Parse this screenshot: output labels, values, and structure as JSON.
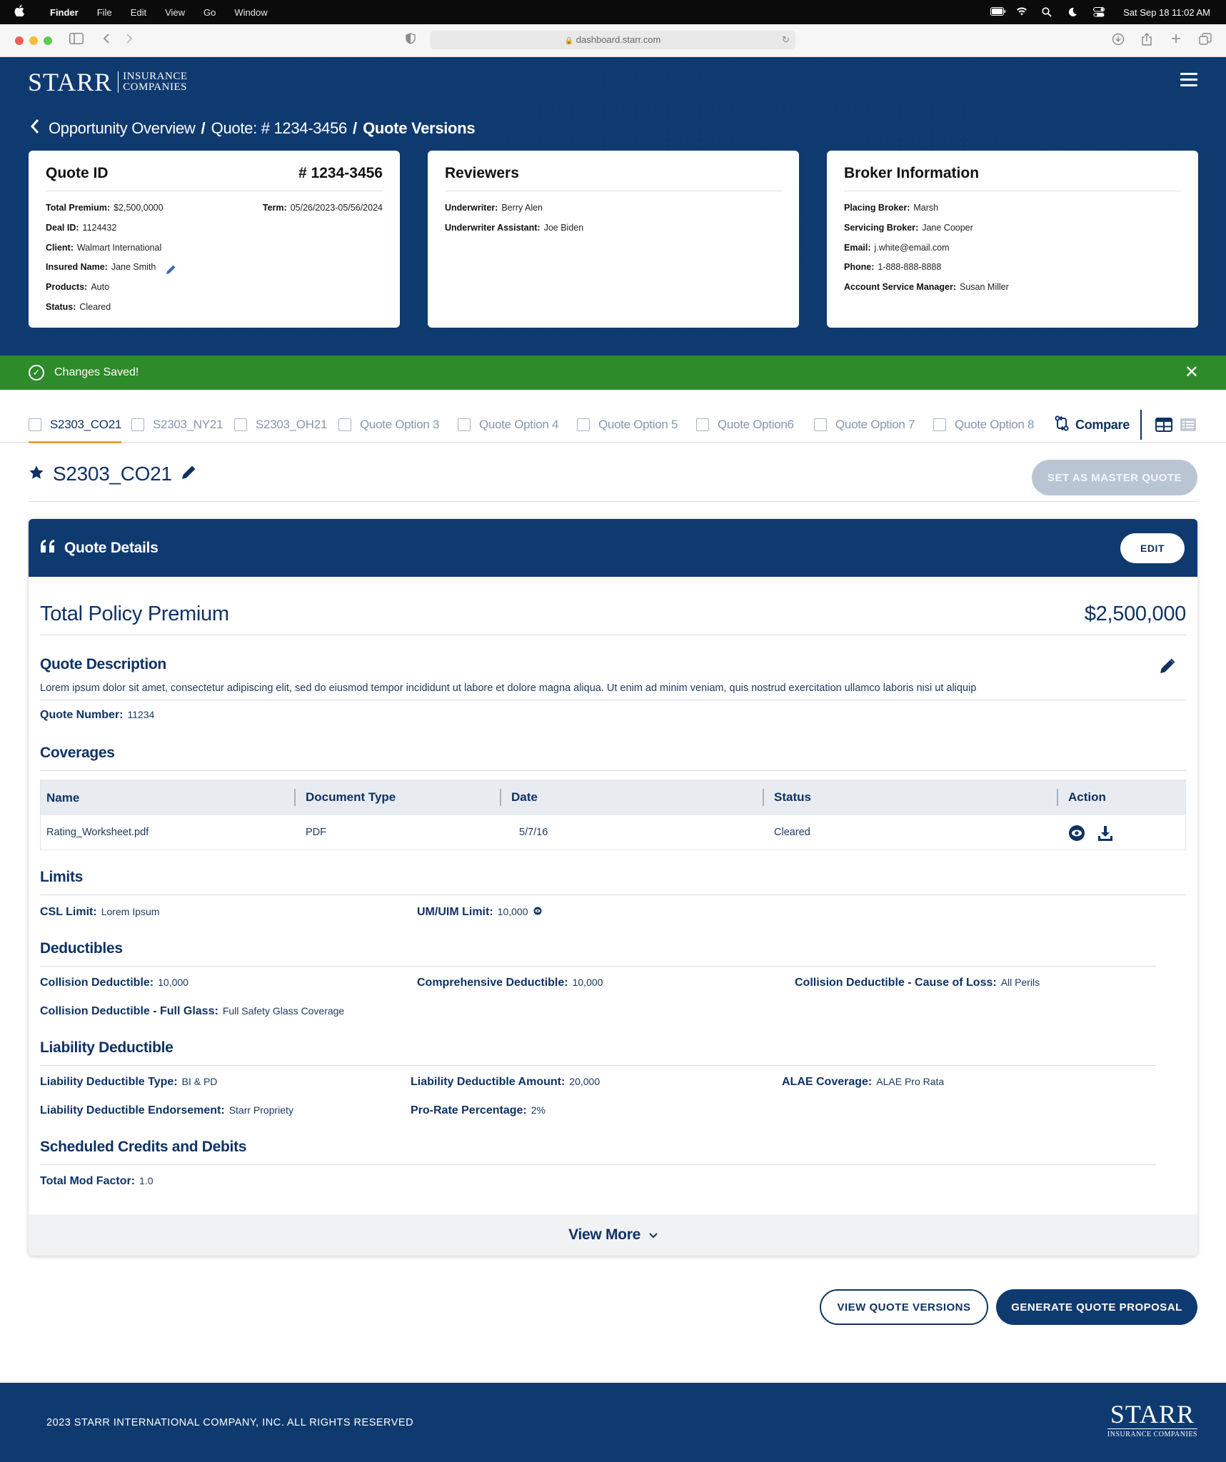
{
  "menubar": {
    "app": "Finder",
    "items": [
      "File",
      "Edit",
      "View",
      "Go",
      "Window"
    ],
    "datetime": "Sat Sep 18  11:02 AM"
  },
  "browser": {
    "url": "dashboard.starr.com"
  },
  "logo": {
    "main": "STARR",
    "line1": "INSURANCE",
    "line2": "COMPANIES"
  },
  "breadcrumb": {
    "items": [
      "Opportunity Overview",
      "Quote: # 1234-3456",
      "Quote Versions"
    ],
    "separator": "/"
  },
  "quote_card": {
    "title": "Quote ID",
    "id": "# 1234-3456",
    "fields": [
      {
        "label": "Total Premium:",
        "value": "$2,500,0000"
      },
      {
        "label": "Deal ID:",
        "value": "1124432"
      },
      {
        "label": "Client:",
        "value": "Walmart International"
      },
      {
        "label": "Insured Name:",
        "value": "Jane Smith"
      },
      {
        "label": "Products:",
        "value": "Auto"
      },
      {
        "label": "Status:",
        "value": "Cleared"
      }
    ],
    "term_label": "Term:",
    "term_value": "05/26/2023-05/56/2024"
  },
  "reviewers_card": {
    "title": "Reviewers",
    "fields": [
      {
        "label": "Underwriter:",
        "value": "Berry Alen"
      },
      {
        "label": "Underwriter Assistant:",
        "value": "Joe Biden"
      }
    ]
  },
  "broker_card": {
    "title": "Broker Information",
    "fields": [
      {
        "label": "Placing Broker:",
        "value": "Marsh"
      },
      {
        "label": "Servicing Broker:",
        "value": "Jane Cooper"
      },
      {
        "label": "Email:",
        "value": "j.white@email.com"
      },
      {
        "label": "Phone:",
        "value": "1-888-888-8888"
      },
      {
        "label": "Account Service Manager:",
        "value": "Susan Miller"
      }
    ]
  },
  "alert": {
    "message": "Changes Saved!",
    "color": "#2e8b2a"
  },
  "tabs": [
    "S2303_CO21",
    "S2303_NY21",
    "S2303_OH21",
    "Quote Option 3",
    "Quote Option 4",
    "Quote Option 5",
    "Quote Option6",
    "Quote Option 7",
    "Quote Option 8"
  ],
  "compare_label": "Compare",
  "quote": {
    "name": "S2303_CO21",
    "master_button": "SET AS MASTER QUOTE"
  },
  "details": {
    "title": "Quote Details",
    "edit_label": "EDIT",
    "total_label": "Total Policy Premium",
    "total_value": "$2,500,000",
    "description_heading": "Quote Description",
    "description_text": "Lorem ipsum dolor sit amet, consectetur adipiscing elit, sed do eiusmod tempor incididunt ut labore et dolore magna aliqua. Ut enim ad minim veniam, quis nostrud exercitation ullamco laboris nisi ut aliquip",
    "quote_number_label": "Quote Number:",
    "quote_number_value": "11234",
    "coverages_heading": "Coverages",
    "coverages_table": {
      "headers": [
        "Name",
        "Document Type",
        "Date",
        "Status",
        "Action"
      ],
      "rows": [
        [
          "Rating_Worksheet.pdf",
          "PDF",
          "5/7/16",
          "Cleared"
        ]
      ]
    },
    "limits_heading": "Limits",
    "limits": [
      {
        "label": "CSL Limit:",
        "value": "Lorem Ipsum"
      },
      {
        "label": "UM/UIM Limit:",
        "value": "10,000"
      }
    ],
    "deductibles_heading": "Deductibles",
    "deductibles": [
      {
        "label": "Collision Deductible:",
        "value": "10,000"
      },
      {
        "label": "Comprehensive Deductible:",
        "value": "10,000"
      },
      {
        "label": "Collision Deductible - Cause of Loss:",
        "value": "All Perils"
      },
      {
        "label": "Collision Deductible - Full Glass:",
        "value": "Full Safety Glass Coverage"
      }
    ],
    "liability_heading": "Liability Deductible",
    "liability": [
      {
        "label": "Liability Deductible Type:",
        "value": "BI & PD"
      },
      {
        "label": "Liability Deductible Amount:",
        "value": "20,000"
      },
      {
        "label": "ALAE Coverage:",
        "value": "ALAE Pro Rata"
      },
      {
        "label": "Liability Deductible Endorsement:",
        "value": "Starr Propriety"
      },
      {
        "label": "Pro-Rate Percentage:",
        "value": "2%"
      }
    ],
    "credits_heading": "Scheduled Credits and Debits",
    "credits": [
      {
        "label": "Total Mod Factor:",
        "value": "1.0"
      }
    ],
    "view_more": "View More"
  },
  "actions": {
    "view_versions": "VIEW QUOTE VERSIONS",
    "generate_proposal": "GENERATE QUOTE PROPOSAL"
  },
  "footer": {
    "copyright": "2023 STARR INTERNATIONAL COMPANY, INC. ALL RIGHTS RESERVED",
    "logo_main": "STARR",
    "logo_sub": "INSURANCE COMPANIES"
  },
  "colors": {
    "brand_navy": "#0f3a70",
    "accent_gold": "#e6a42b",
    "success_green": "#2e8b2a"
  }
}
